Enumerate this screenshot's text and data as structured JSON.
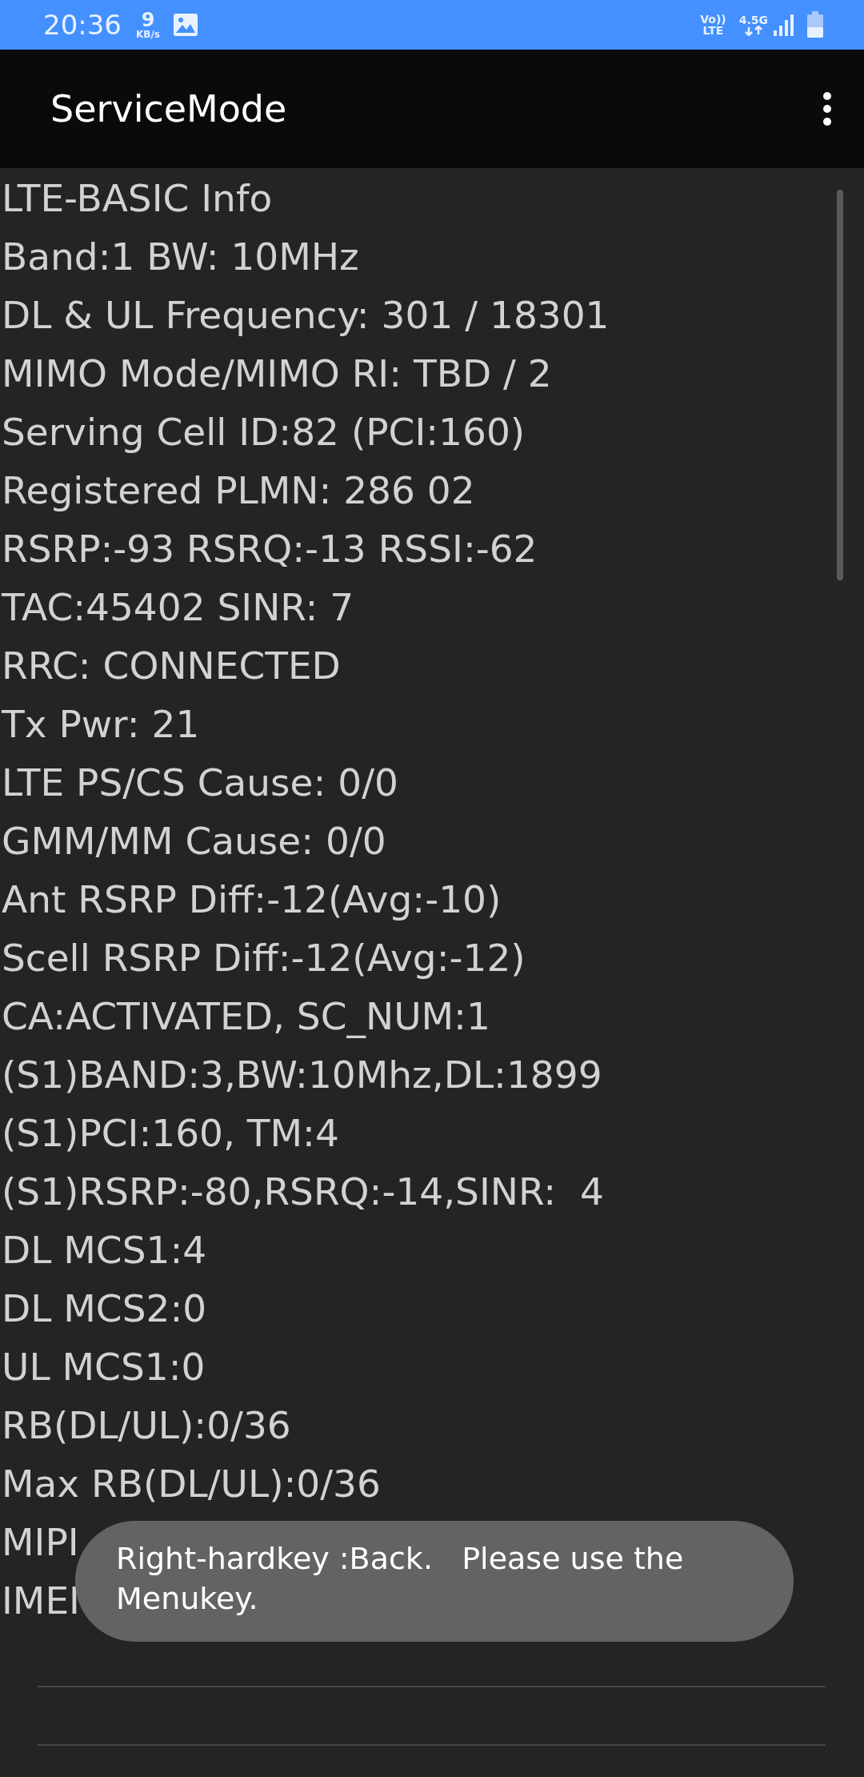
{
  "status_bar": {
    "time": "20:36",
    "speed_value": "9",
    "speed_unit": "KB/s",
    "volte_top": "Vo))",
    "volte_bottom": "LTE",
    "network": "4.5G"
  },
  "app_bar": {
    "title": "ServiceMode"
  },
  "rows": [
    "LTE-BASIC Info",
    "Band:1 BW: 10MHz",
    "DL & UL Frequency: 301 / 18301",
    "MIMO Mode/MIMO RI: TBD / 2",
    "Serving Cell ID:82 (PCI:160)",
    "Registered PLMN: 286 02",
    "RSRP:-93 RSRQ:-13 RSSI:-62",
    "TAC:45402 SINR: 7",
    "RRC: CONNECTED",
    "Tx Pwr: 21",
    "LTE PS/CS Cause: 0/0",
    "GMM/MM Cause: 0/0",
    "Ant RSRP Diff:-12(Avg:-10)",
    "Scell RSRP Diff:-12(Avg:-12)",
    "CA:ACTIVATED, SC_NUM:1",
    "(S1)BAND:3,BW:10Mhz,DL:1899",
    "(S1)PCI:160, TM:4",
    "(S1)RSRP:-80,RSRQ:-14,SINR:  4",
    "DL MCS1:4",
    "DL MCS2:0",
    "UL MCS1:0",
    "RB(DL/UL):0/36",
    "Max RB(DL/UL):0/36",
    "MIPI",
    "IMEI"
  ],
  "toast": {
    "message": "Right-hardkey :Back.   Please use the Menukey."
  }
}
